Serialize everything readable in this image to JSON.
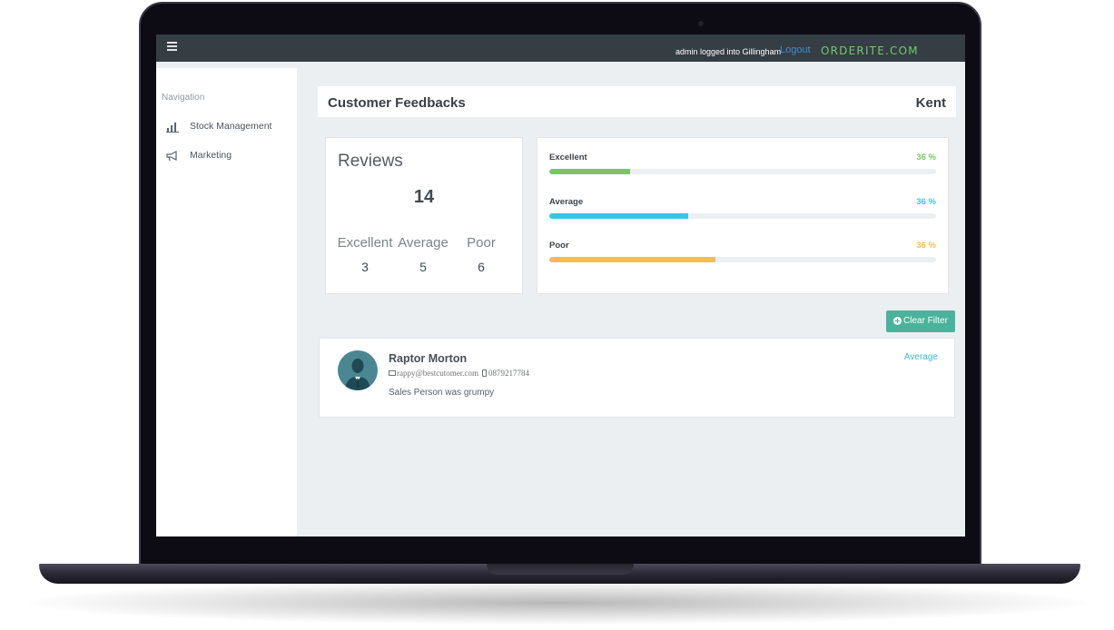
{
  "topbar": {
    "user_text": "admin logged into Gillingham",
    "logout_label": "Logout",
    "brand": "ORDERITE.COM"
  },
  "sidebar": {
    "heading": "Navigation",
    "items": [
      {
        "label": "Stock Management",
        "icon": "bar-chart-icon"
      },
      {
        "label": "Marketing",
        "icon": "megaphone-icon"
      }
    ]
  },
  "header": {
    "title": "Customer Feedbacks",
    "location": "Kent"
  },
  "reviews": {
    "title": "Reviews",
    "total": "14",
    "breakdown": [
      {
        "label": "Excellent",
        "count": "3"
      },
      {
        "label": "Average",
        "count": "5"
      },
      {
        "label": "Poor",
        "count": "6"
      }
    ]
  },
  "rating_bars": [
    {
      "label": "Excellent",
      "percent_text": "36 %",
      "fill_fraction": 0.21,
      "color": "#7bc465"
    },
    {
      "label": "Average",
      "percent_text": "36 %",
      "fill_fraction": 0.36,
      "color": "#39c6e3"
    },
    {
      "label": "Poor",
      "percent_text": "36 %",
      "fill_fraction": 0.43,
      "color": "#ffbb4d"
    }
  ],
  "clear_filter_label": "Clear Filter",
  "feedback": {
    "name": "Raptor Morton",
    "email": "rappy@bestcutomer.com",
    "phone": "0879217784",
    "comment": "Sales Person was grumpy",
    "rating": "Average"
  },
  "colors": {
    "topbar": "#353d45",
    "accent_link": "#3d8fd6",
    "brand": "#74c86c",
    "button": "#4bb39b"
  }
}
